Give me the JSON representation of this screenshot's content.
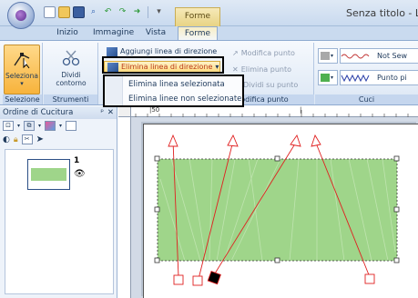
{
  "window": {
    "title": "Senza titolo - L",
    "context_tab_title": "Forme"
  },
  "tabs": [
    {
      "label": "Inizio"
    },
    {
      "label": "Immagine"
    },
    {
      "label": "Vista"
    },
    {
      "label": "Forme"
    }
  ],
  "ribbon": {
    "groups": {
      "selezione": {
        "label": "Selezione",
        "button": "Seleziona"
      },
      "strumenti": {
        "label": "Strumenti",
        "button_line1": "Dividi",
        "button_line2": "contorno"
      },
      "modifica": {
        "label": "Modifica punto",
        "aggiungi": "Aggiungi linea di direzione",
        "elimina": "Elimina linea di direzione",
        "modifica_punto": "Modifica punto",
        "elimina_punto": "Elimina punto",
        "dividi_punto": "Dividi su punto"
      },
      "cuci": {
        "label": "Cuci",
        "style1": "Not Sew",
        "style2": "Punto pi"
      }
    }
  },
  "dropdown": {
    "items": [
      "Elimina linea selezionata",
      "Elimina linee non selezionate"
    ]
  },
  "panel": {
    "title": "Ordine di Cucitura",
    "items": [
      {
        "number": "1"
      }
    ]
  },
  "ruler": {
    "top_labels": [
      "|50",
      "|"
    ]
  },
  "colors": {
    "fill": "#9fd58a",
    "direction_line": "#e02020",
    "accent_selected": "#f7b33c"
  }
}
